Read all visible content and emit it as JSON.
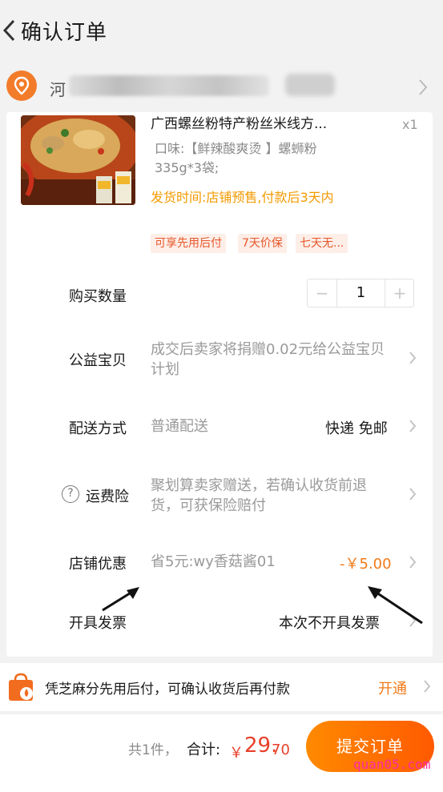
{
  "header": {
    "title": "确认订单"
  },
  "address": {
    "text": "河"
  },
  "product": {
    "title": "广西螺丝粉特产粉丝米线方...",
    "quantity_badge": "x1",
    "spec": "口味:【鲜辣酸爽烫 】螺蛳粉335g*3袋;",
    "ship_time": "发货时间:店铺预售,付款后3天内",
    "tags": [
      "可享先用后付",
      "7天价保",
      "七天无..."
    ]
  },
  "rows": {
    "quantity": {
      "label": "购买数量",
      "minus": "−",
      "value": "1",
      "plus": "+"
    },
    "charity": {
      "label": "公益宝贝",
      "value": "成交后卖家将捐赠0.02元给公益宝贝计划"
    },
    "delivery": {
      "label": "配送方式",
      "value": "普通配送",
      "right": "快递 免邮"
    },
    "insurance": {
      "label": "运费险",
      "icon_glyph": "?",
      "value": "聚划算卖家赠送，若确认收货前退货，可获保险赔付"
    },
    "store_discount": {
      "label": "店铺优惠",
      "value": "省5元:wy香菇酱01",
      "amount": "-￥5.00"
    },
    "invoice": {
      "label": "开具发票",
      "value": "本次不开具发票"
    }
  },
  "sesame": {
    "text": "凭芝麻分先用后付，可确认收货后再付款",
    "action": "开通"
  },
  "footer": {
    "count": "共1件，",
    "total_label": "合计:",
    "currency": "￥",
    "total_main": "29.",
    "total_cents": "70",
    "submit": "提交订单"
  },
  "watermark": "quan05.com",
  "colors": {
    "accent": "#f07a18",
    "price": "#e8402a",
    "submit_start": "#ff8a00",
    "submit_end": "#ff5a00"
  },
  "icons": [
    "back-arrow-icon",
    "location-pin-icon",
    "chevron-right-icon",
    "question-circle-icon",
    "shopping-bag-icon"
  ]
}
